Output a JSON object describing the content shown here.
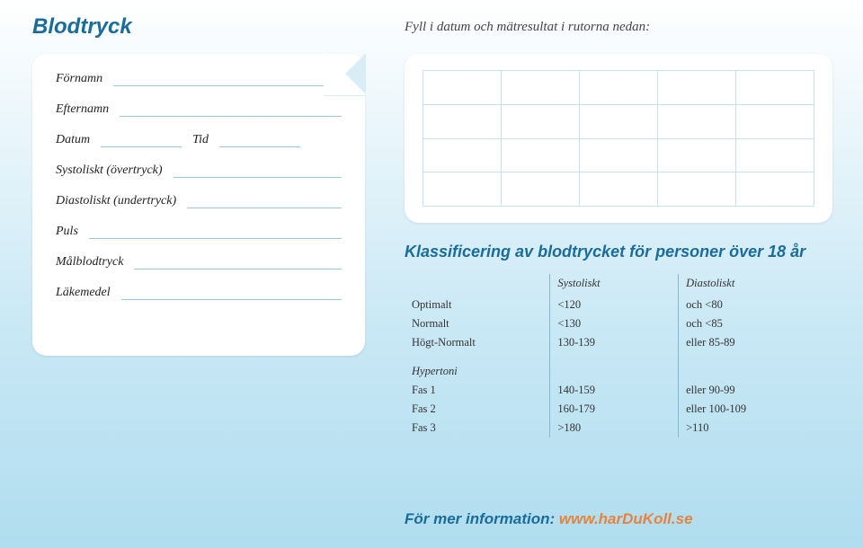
{
  "title": "Blodtryck",
  "instruction": "Fyll i datum och mätresultat i rutorna nedan:",
  "form": {
    "fornamn": "Förnamn",
    "efternamn": "Efternamn",
    "datum": "Datum",
    "tid": "Tid",
    "systoliskt": "Systoliskt (övertryck)",
    "diastoliskt": "Diastoliskt (undertryck)",
    "puls": "Puls",
    "malblodtryck": "Målblodtryck",
    "lakemedel": "Läkemedel"
  },
  "classification": {
    "title": "Klassificering av blodtrycket för personer över 18 år",
    "col_systoliskt": "Systoliskt",
    "col_diastoliskt": "Diastoliskt",
    "rows_normal": [
      {
        "label": "Optimalt",
        "sys": "<120",
        "dia": "och <80"
      },
      {
        "label": "Normalt",
        "sys": "<130",
        "dia": "och <85"
      },
      {
        "label": "Högt-Normalt",
        "sys": "130-139",
        "dia": "eller 85-89"
      }
    ],
    "hypertoni_label": "Hypertoni",
    "rows_hyper": [
      {
        "label": "Fas 1",
        "sys": "140-159",
        "dia": "eller 90-99"
      },
      {
        "label": "Fas 2",
        "sys": "160-179",
        "dia": "eller 100-109"
      },
      {
        "label": "Fas 3",
        "sys": ">180",
        "dia": ">110"
      }
    ]
  },
  "footer": {
    "lead": "För mer information: ",
    "url_prefix": "www.",
    "url_main": "harDuKoll",
    "url_suffix": ".se"
  }
}
